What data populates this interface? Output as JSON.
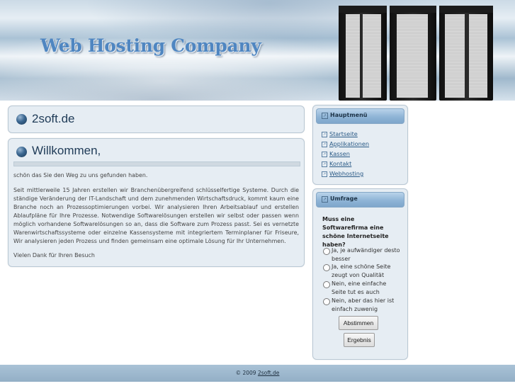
{
  "header": {
    "site_title": "Web Hosting Company"
  },
  "main": {
    "box1_title": "2soft.de",
    "welcome": {
      "title": "Willkommen,",
      "intro": "schön das Sie den Weg zu uns gefunden haben.",
      "body": "Seit mittlerweile 15 Jahren erstellen wir Branchenübergreifend schlüsselfertige Systeme. Durch die ständige Veränderung der IT-Landschaft und dem zunehmenden Wirtschaftsdruck, kommt kaum eine Branche noch an Prozessoptimierungen vorbei. Wir analysieren Ihren Arbeitsablauf und erstellen Ablaufpläne für Ihre Prozesse. Notwendige Softwarelösungen erstellen wir selbst oder passen wenn möglich vorhandene Softwarelösungen so an, dass die Software zum Prozess passt. Sei es vernetzte Warenwirtschaftssysteme oder einzelne Kassensysteme mit integriertem Terminplaner für Friseure, Wir analysieren jeden Prozess und finden gemeinsam eine optimale Lösung für Ihr Unternehmen.",
      "closing": "Vielen Dank für Ihren Besuch"
    }
  },
  "sidebar": {
    "menu": {
      "title": "Hauptmenü",
      "items": [
        "Startseite",
        "Applikationen",
        "Kassen",
        "Kontakt",
        "Webhosting"
      ]
    },
    "poll": {
      "title": "Umfrage",
      "question": "Muss eine Softwarefirma eine schöne Internetseite haben?",
      "options": [
        "Ja, je aufwändiger desto besser",
        "Ja, eine schöne Seite zeugt von Qualität",
        "Nein, eine einfache Seite tut es auch",
        "Nein, aber das hier ist einfach zuwenig"
      ],
      "vote_label": "Abstimmen",
      "results_label": "Ergebnis"
    }
  },
  "footer": {
    "copyright": "© 2009",
    "link": "2soft.de"
  }
}
